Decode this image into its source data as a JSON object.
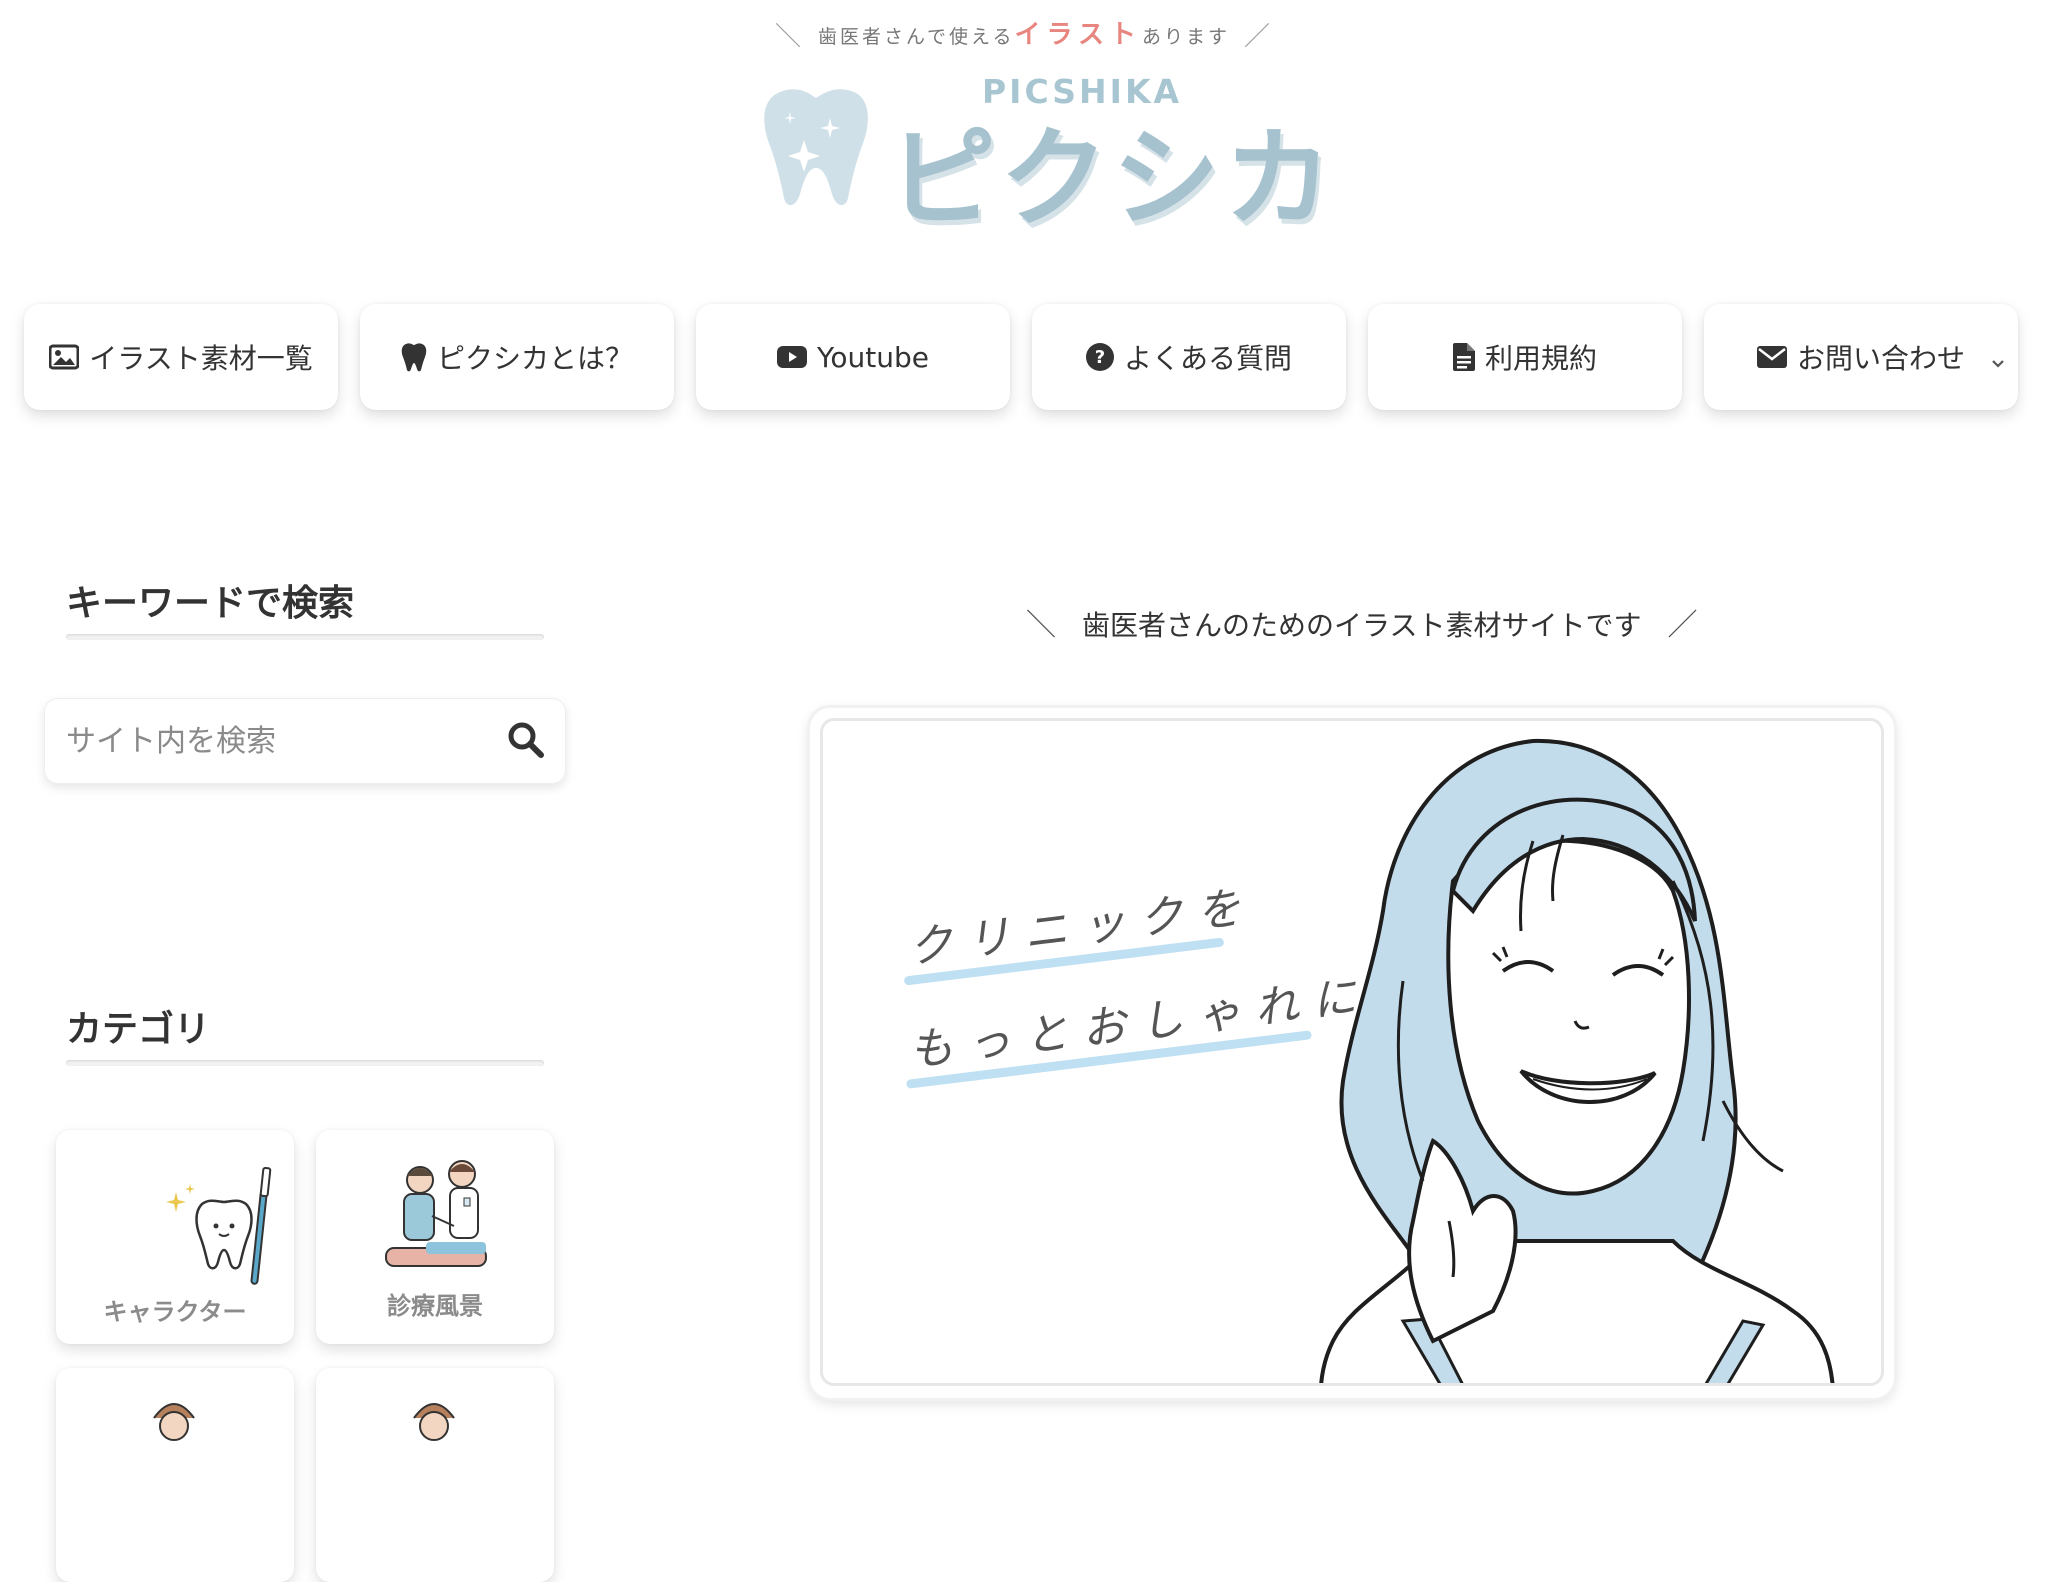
{
  "header": {
    "tagline_prefix": "歯医者さんで使える",
    "tagline_accent": "イラスト",
    "tagline_suffix": "あります",
    "logo_sub": "PICSHIKA",
    "logo_main": "ピクシカ"
  },
  "nav": {
    "items": [
      {
        "label": "イラスト素材一覧",
        "icon": "image-icon"
      },
      {
        "label": "ピクシカとは？",
        "icon": "tooth-icon"
      },
      {
        "label": "Youtube",
        "icon": "youtube-icon"
      },
      {
        "label": "よくある質問",
        "icon": "question-circle-icon"
      },
      {
        "label": "利用規約",
        "icon": "document-icon"
      },
      {
        "label": "お問い合わせ",
        "icon": "envelope-icon"
      }
    ]
  },
  "sidebar": {
    "search_title": "キーワードで検索",
    "search_placeholder": "サイト内を検索",
    "category_title": "カテゴリ",
    "categories": [
      {
        "label": "キャラクター"
      },
      {
        "label": "診療風景"
      }
    ]
  },
  "main": {
    "lead": "歯医者さんのためのイラスト素材サイトです",
    "hero_line1": "クリニックを",
    "hero_line2": "もっとおしゃれに"
  },
  "colors": {
    "accent": "#e8857e",
    "logo": "#a7c2cf",
    "hair_blue": "#c3dcec",
    "hero_underline": "#bfe0f3"
  }
}
